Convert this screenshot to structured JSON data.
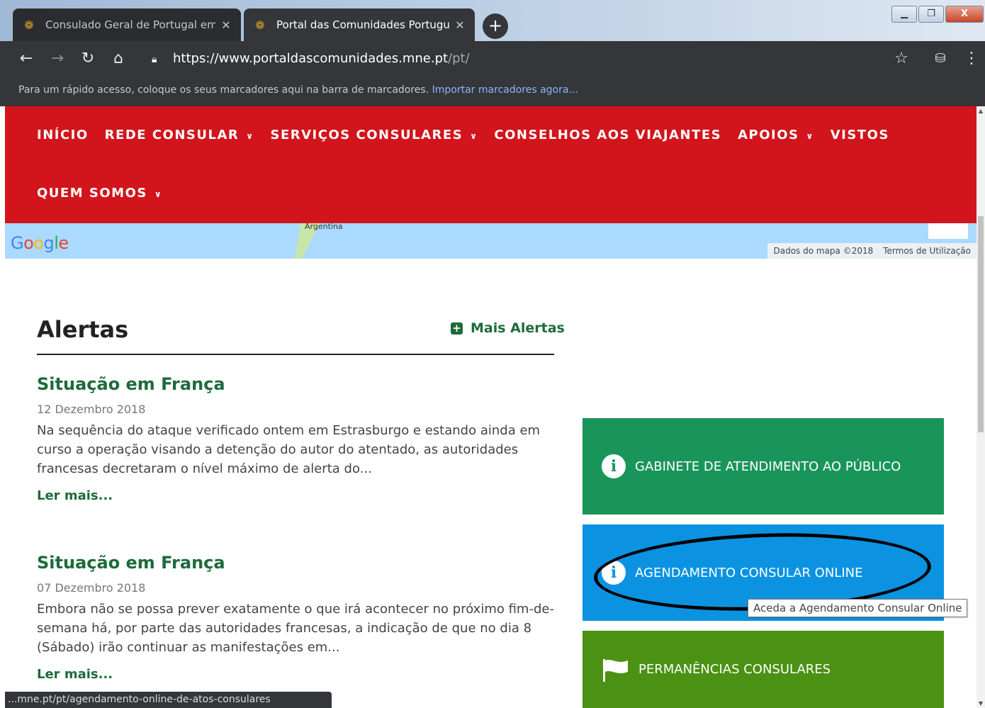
{
  "browser": {
    "tabs": [
      {
        "title": "Consulado Geral de Portugal em",
        "active": false
      },
      {
        "title": "Portal das Comunidades Portugu",
        "active": true
      }
    ],
    "new_tab": "+",
    "url_host": "https://www.portaldascomunidades.mne.pt",
    "url_path": "/pt/",
    "bookmarks_text": "Para um rápido acesso, coloque os seus marcadores aqui na barra de marcadores.",
    "bookmarks_link": "Importar marcadores agora...",
    "status_url": "...mne.pt/pt/agendamento-online-de-atos-consulares"
  },
  "nav": {
    "row1": [
      {
        "label": "INÍCIO",
        "dropdown": false
      },
      {
        "label": "REDE CONSULAR",
        "dropdown": true
      },
      {
        "label": "SERVIÇOS CONSULARES",
        "dropdown": true
      },
      {
        "label": "CONSELHOS AOS VIAJANTES",
        "dropdown": false
      },
      {
        "label": "APOIOS",
        "dropdown": true
      },
      {
        "label": "VISTOS",
        "dropdown": false
      }
    ],
    "row2": [
      {
        "label": "QUEM SOMOS",
        "dropdown": true
      }
    ]
  },
  "map": {
    "logo": [
      "G",
      "o",
      "o",
      "g",
      "l",
      "e"
    ],
    "place_label": "Argentina",
    "data_credit": "Dados do mapa ©2018",
    "terms": "Termos de Utilização"
  },
  "alerts": {
    "title": "Alertas",
    "more_label": "Mais Alertas",
    "items": [
      {
        "title": "Situação em França",
        "date": "12 Dezembro 2018",
        "lines": [
          "Na sequência do ataque verificado ontem em Estrasburgo e estando ainda em",
          "curso a operação visando a detenção do autor do atentado, as autoridades",
          "francesas decretaram o nível máximo de alerta do..."
        ],
        "more": "Ler mais..."
      },
      {
        "title": "Situação em França",
        "date": "07 Dezembro 2018",
        "lines": [
          "Embora não se possa prever exatamente o que irá acontecer no próximo fim-de-",
          "semana há, por parte das autoridades francesas, a indicação de que no dia 8",
          "(Sábado) irão continuar as manifestações em..."
        ],
        "more": "Ler mais..."
      }
    ]
  },
  "panels": [
    {
      "label": "GABINETE DE ATENDIMENTO AO PÚBLICO",
      "icon": "info-icon",
      "color": "#1a955a"
    },
    {
      "label": "AGENDAMENTO CONSULAR ONLINE",
      "icon": "info-icon",
      "color": "#0b93e2"
    },
    {
      "label": "PERMANÊNCIAS CONSULARES",
      "icon": "flag-icon",
      "color": "#4b9113"
    }
  ],
  "tooltip": "Aceda a Agendamento Consular Online"
}
